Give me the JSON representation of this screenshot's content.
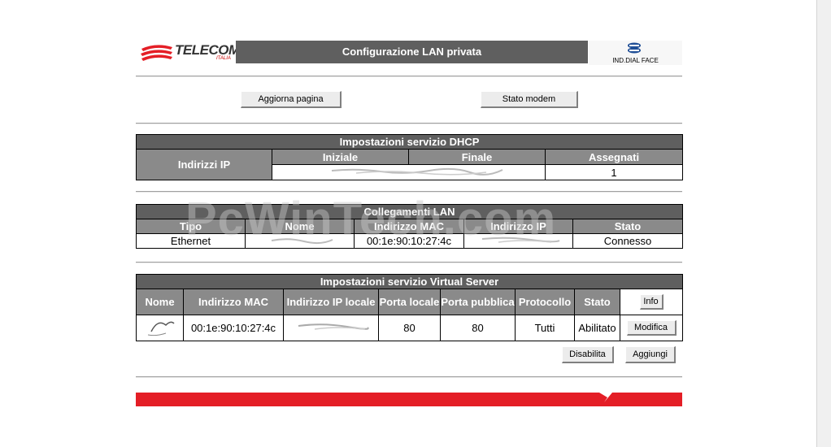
{
  "header": {
    "logo_text": "TELECOM",
    "logo_sub": "ITALIA",
    "title": "Configurazione LAN privata",
    "mode_label": "IND.DIAL FACE"
  },
  "toolbar": {
    "refresh_label": "Aggiorna pagina",
    "status_label": "Stato modem"
  },
  "dhcp": {
    "caption": "Impostazioni servizio DHCP",
    "row_header": "Indirizzi IP",
    "columns": [
      "Iniziale",
      "Finale",
      "Assegnati"
    ],
    "assigned": "1"
  },
  "lan": {
    "caption": "Collegamenti LAN",
    "columns": [
      "Tipo",
      "Nome",
      "Indirizzo MAC",
      "Indirizzo IP",
      "Stato"
    ],
    "rows": [
      {
        "type": "Ethernet",
        "mac": "00:1e:90:10:27:4c",
        "status": "Connesso"
      }
    ]
  },
  "virtual_server": {
    "caption": "Impostazioni servizio Virtual Server",
    "columns": [
      "Nome",
      "Indirizzo MAC",
      "Indirizzo IP locale",
      "Porta locale",
      "Porta pubblica",
      "Protocollo",
      "Stato"
    ],
    "info_label": "Info",
    "rows": [
      {
        "mac": "00:1e:90:10:27:4c",
        "local_port": "80",
        "public_port": "80",
        "protocol": "Tutti",
        "status": "Abilitato",
        "edit_label": "Modifica"
      }
    ],
    "disable_label": "Disabilita",
    "add_label": "Aggiungi"
  },
  "watermark": "PcWinTech.com",
  "colors": {
    "title_bar": "#5f5f5f",
    "table_header": "#8a8a8a",
    "footer": "#e41e26",
    "logo_red": "#e41e26"
  }
}
